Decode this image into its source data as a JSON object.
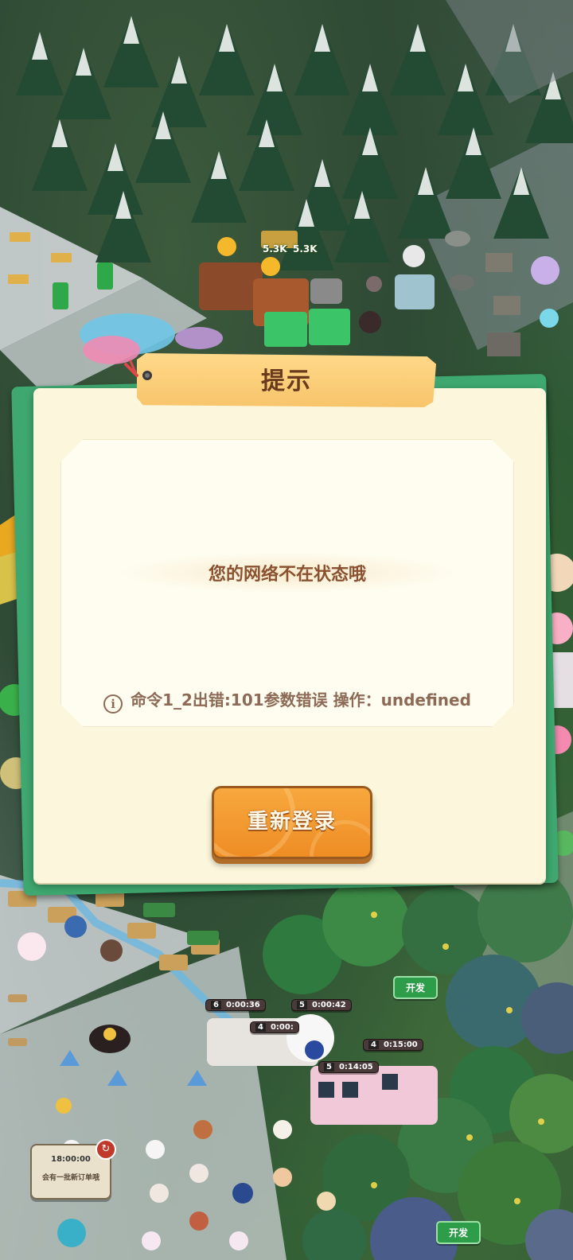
{
  "dialog": {
    "title": "提示",
    "message": "您的网络不在状态哦",
    "error_text": "命令1_2出错:101参数错误  操作：undefined",
    "info_icon": "info-icon",
    "button_label": "重新登录",
    "colors": {
      "panel": "#fcf7dc",
      "back_card": "#3fa870",
      "banner": "#f7c46a",
      "title_text": "#6a3a1e",
      "message_text": "#8a5230",
      "button": "#ee8d24"
    }
  },
  "background": {
    "price_tags": [
      "5.3K",
      "5.3K"
    ],
    "dev_badges": [
      "开发",
      "开发"
    ],
    "timers": [
      {
        "level": "6",
        "time": "0:00:36"
      },
      {
        "level": "5",
        "time": "0:00:42"
      },
      {
        "level": "4",
        "time": "0:00:"
      },
      {
        "level": "4",
        "time": "0:15:00"
      },
      {
        "level": "5",
        "time": "0:14:05"
      }
    ],
    "order_card": {
      "time": "18:00:00",
      "text": "会有一批新订单哦"
    }
  }
}
